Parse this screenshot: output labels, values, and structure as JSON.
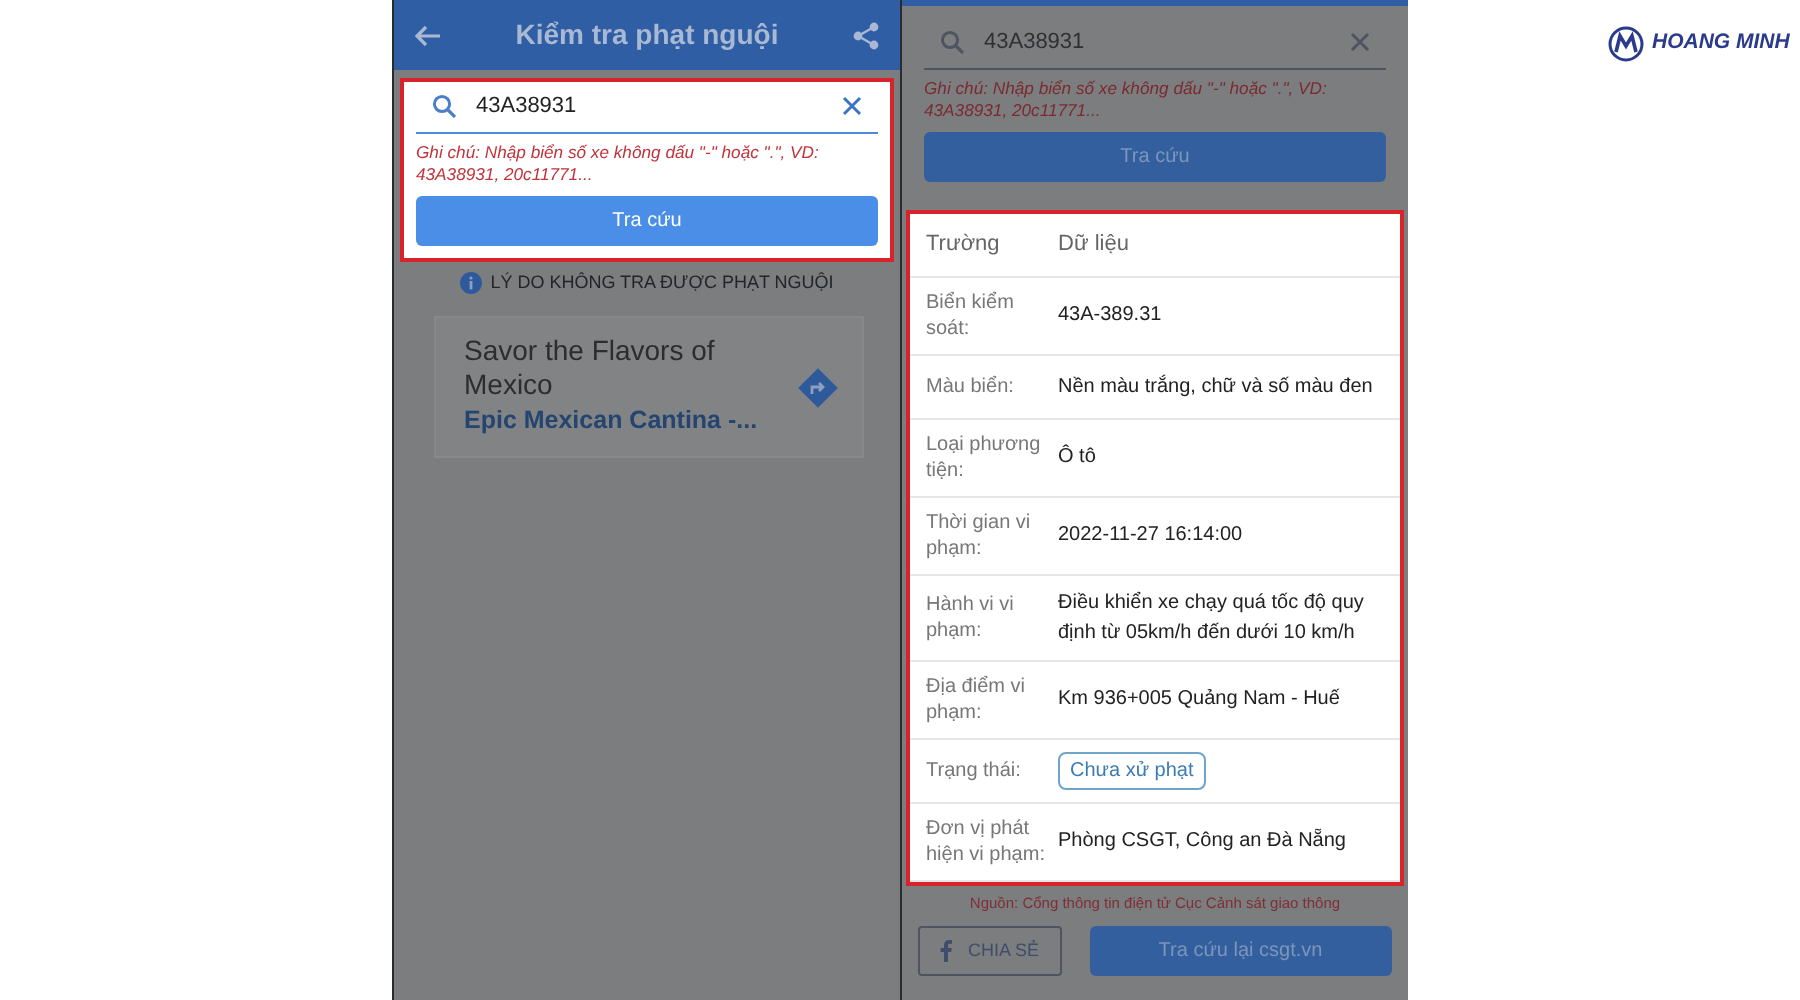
{
  "left_screen": {
    "header": {
      "title": "Kiểm tra phạt nguội"
    },
    "search_panel": {
      "highlighted": true,
      "value": "43A38931",
      "note": "Ghi chú: Nhập biển số xe không dấu \"-\" hoặc \".\", VD: 43A38931, 20c11771...",
      "button": "Tra cứu"
    },
    "help_link": "LÝ DO KHÔNG TRA ĐƯỢC PHẠT NGUỘI",
    "ad": {
      "title": "Savor the Flavors of Mexico",
      "subtitle": "Epic Mexican Cantina -..."
    }
  },
  "right_screen": {
    "search_panel": {
      "highlighted": false,
      "value": "43A38931",
      "note": "Ghi chú: Nhập biển số xe không dấu \"-\" hoặc \".\", VD: 43A38931, 20c11771...",
      "button": "Tra cứu"
    },
    "table": {
      "highlighted": true,
      "columns": [
        "Trường",
        "Dữ liệu"
      ],
      "rows": [
        {
          "kind": "text",
          "field": "Biển kiểm soát:",
          "value": "43A-389.31"
        },
        {
          "kind": "text",
          "field": "Màu biển:",
          "value": "Nền màu trắng, chữ và số màu đen"
        },
        {
          "kind": "text",
          "field": "Loại phương tiện:",
          "value": "Ô tô"
        },
        {
          "kind": "text",
          "field": "Thời gian vi phạm:",
          "value": "2022-11-27 16:14:00"
        },
        {
          "kind": "text",
          "field": "Hành vi vi phạm:",
          "value": "Điều khiển xe chạy quá tốc độ quy định từ 05km/h đến dưới 10 km/h"
        },
        {
          "kind": "text",
          "field": "Địa điểm vi phạm:",
          "value": "Km 936+005 Quảng Nam - Huế"
        },
        {
          "kind": "badge",
          "field": "Trạng thái:",
          "value": "Chưa xử phạt"
        },
        {
          "kind": "text",
          "field": "Đơn vị phát hiện vi phạm:",
          "value": "Phòng CSGT, Công an  Đà Nẵng"
        }
      ]
    },
    "source": "Nguồn: Cổng thông tin điện tử Cục Cảnh sát giao thông",
    "share_button": "CHIA SẺ",
    "recheck_button": "Tra cứu lại csgt.vn"
  },
  "logo": {
    "name": "HOANG MINH"
  }
}
